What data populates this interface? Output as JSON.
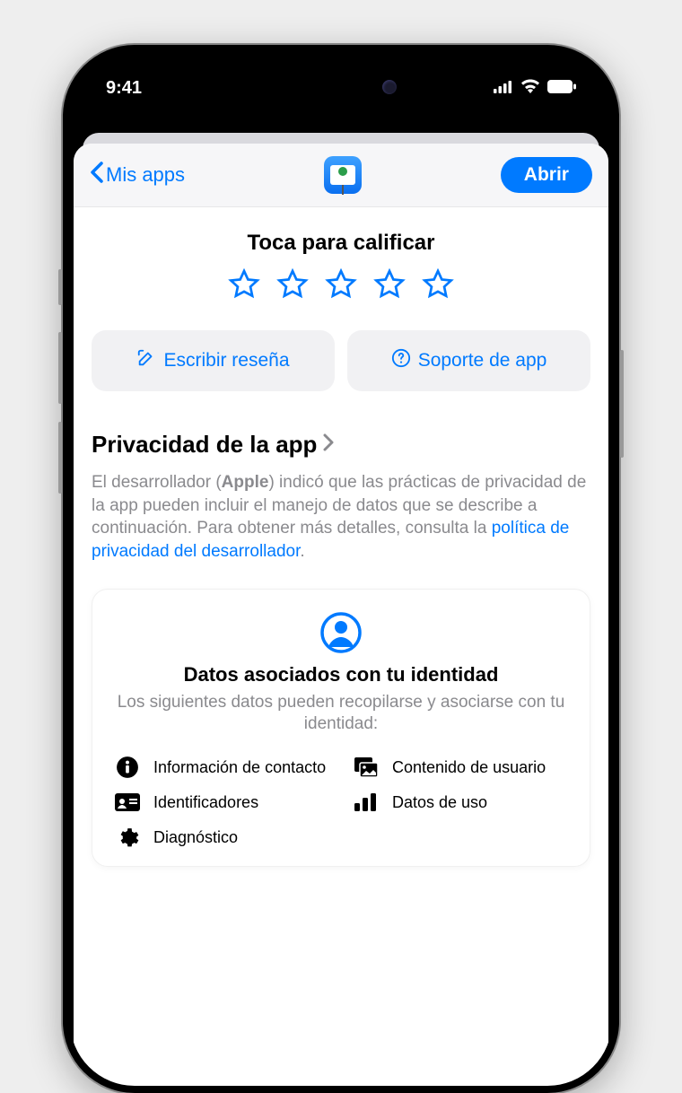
{
  "statusBar": {
    "time": "9:41"
  },
  "nav": {
    "back": "Mis apps",
    "open": "Abrir"
  },
  "rating": {
    "title": "Toca para calificar"
  },
  "actions": {
    "review": "Escribir reseña",
    "support": "Soporte de app"
  },
  "privacy": {
    "title": "Privacidad de la app",
    "body_1": "El desarrollador (",
    "developer": "Apple",
    "body_2": ") indicó que las prácticas de privacidad de la app pueden incluir el manejo de datos que se describe a continuación. Para obtener más detalles, consulta la ",
    "link": "política de privacidad del desarrollador",
    "body_3": "."
  },
  "card": {
    "title": "Datos asociados con tu identidad",
    "sub": "Los siguientes datos pueden recopilarse y asociarse con tu identidad:",
    "items": {
      "contact": "Información de contacto",
      "user_content": "Contenido de usuario",
      "identifiers": "Identificadores",
      "usage": "Datos de uso",
      "diagnostics": "Diagnóstico"
    }
  }
}
